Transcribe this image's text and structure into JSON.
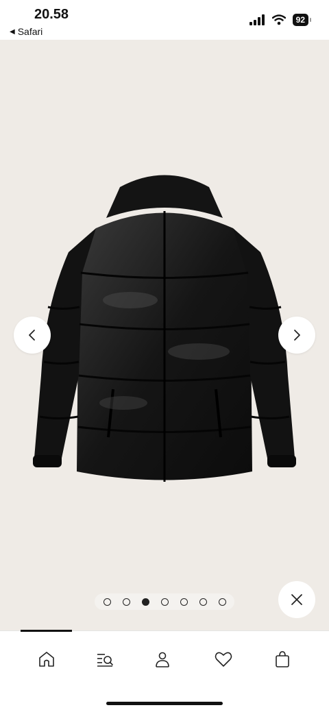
{
  "status_bar": {
    "time": "20.58",
    "back_app_label": "Safari",
    "battery_level": "92"
  },
  "gallery": {
    "image_subject": "black puffer jacket with hood",
    "page_count": 7,
    "current_page": 3,
    "prev_icon": "chevron-left-icon",
    "next_icon": "chevron-right-icon",
    "close_icon": "close-icon"
  },
  "tab_bar": {
    "items": [
      {
        "icon": "home-icon"
      },
      {
        "icon": "search-icon"
      },
      {
        "icon": "account-icon"
      },
      {
        "icon": "heart-icon"
      },
      {
        "icon": "bag-icon"
      }
    ],
    "active_index": 0
  },
  "colors": {
    "background": "#efebe6",
    "accent": "#111111"
  }
}
